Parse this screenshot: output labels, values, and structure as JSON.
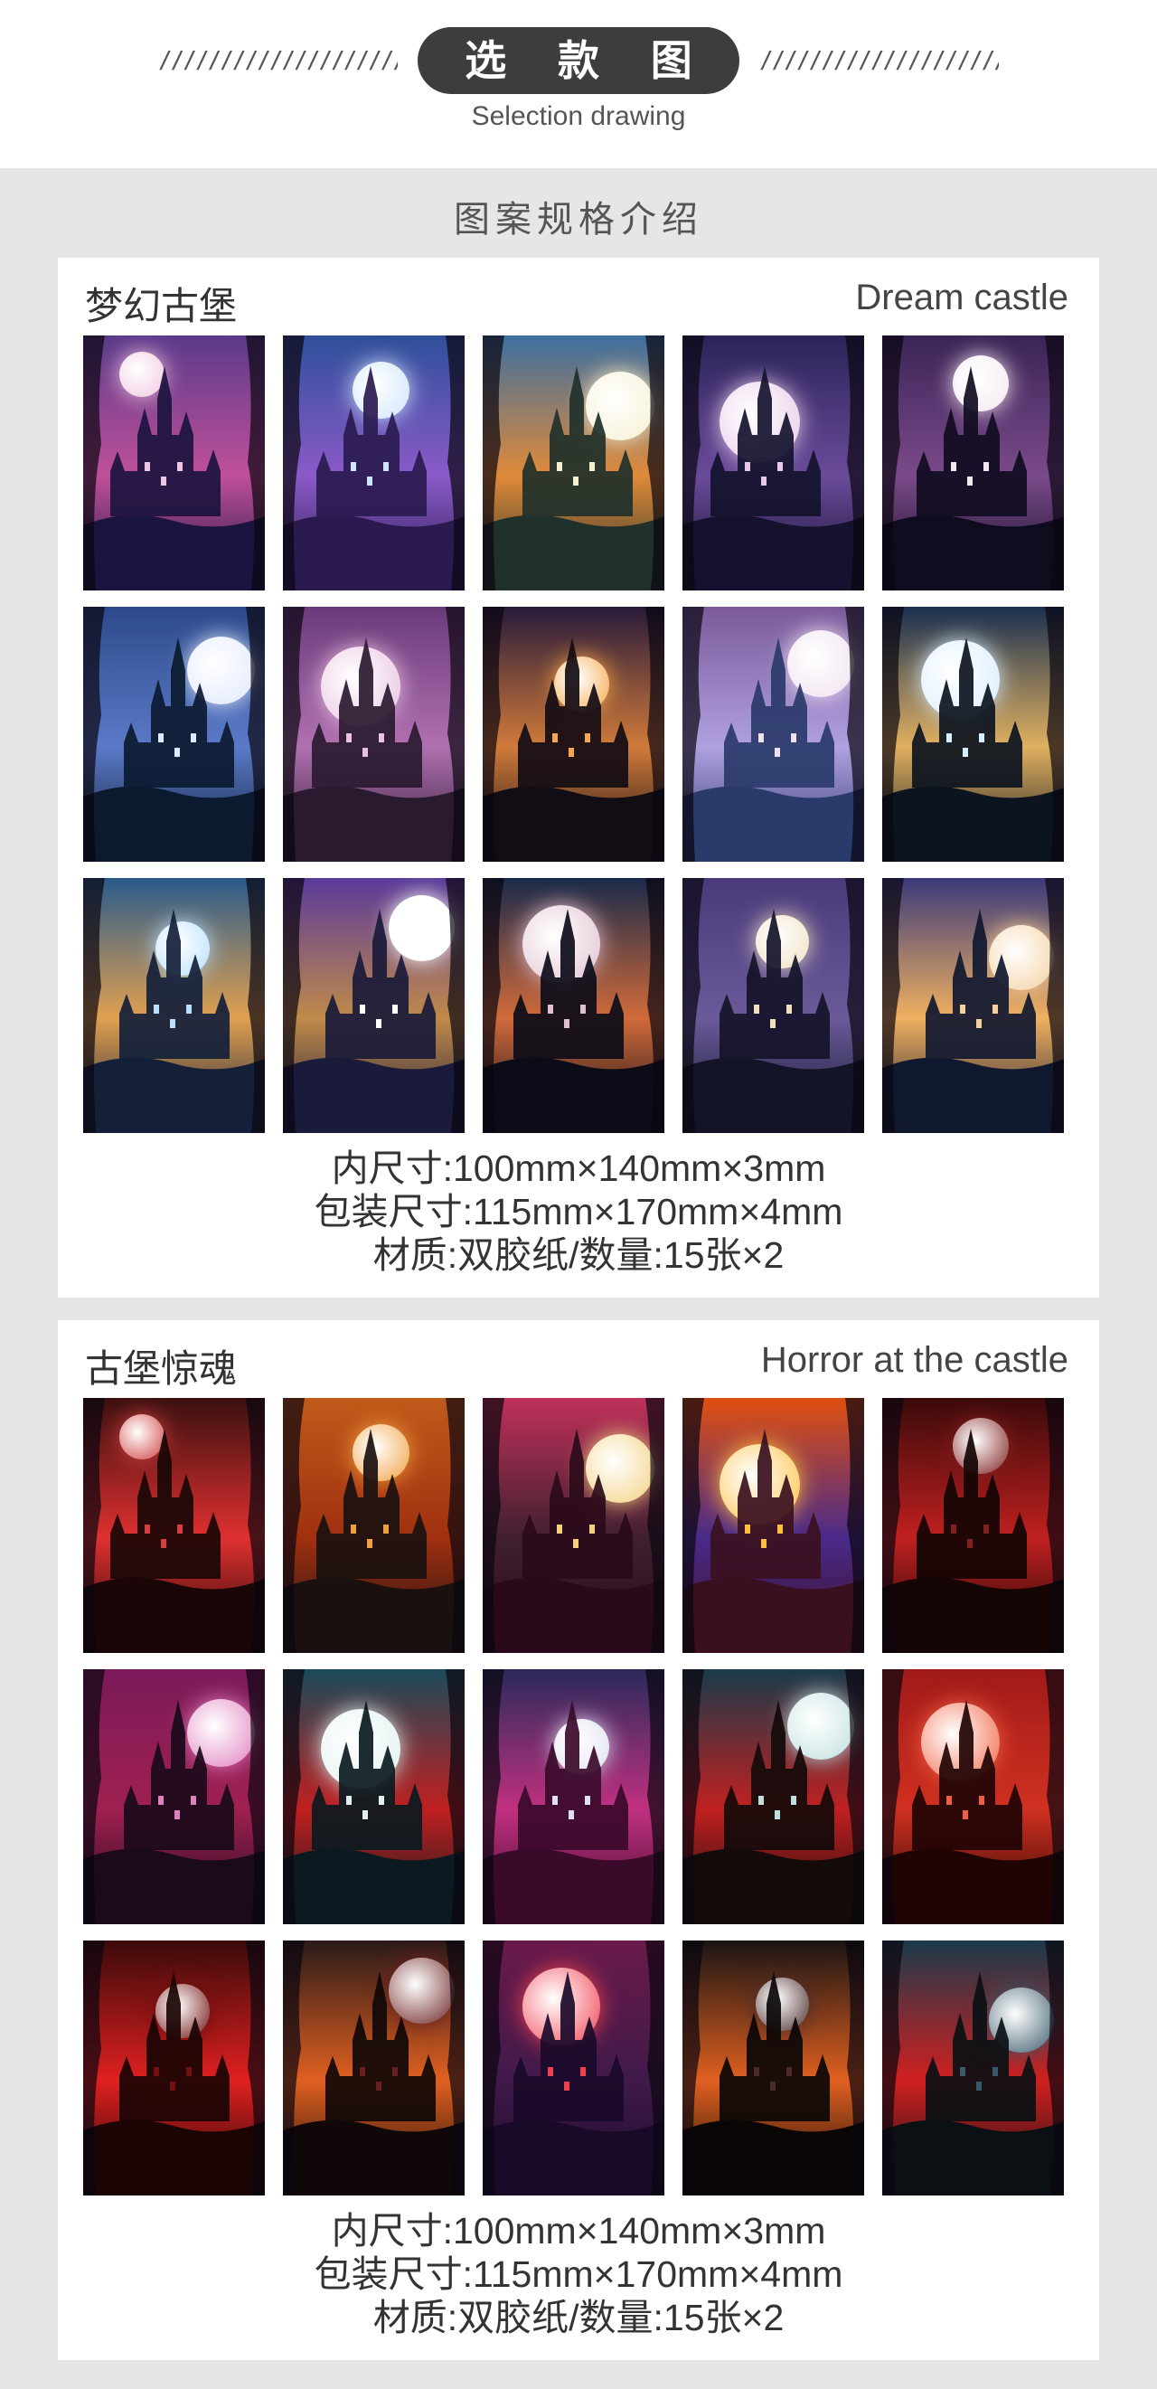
{
  "header": {
    "deco_left": "//////////////////////////",
    "deco_right": "//////////////////////////",
    "title": "选 款 图",
    "subtitle": "Selection drawing"
  },
  "section_heading": "图案规格介绍",
  "panels": [
    {
      "title_cn": "梦幻古堡",
      "title_en": "Dream castle",
      "specs": [
        "内尺寸:100mm×140mm×3mm",
        "包装尺寸:115mm×170mm×4mm",
        "材质:双胶纸/数量:15张×2"
      ],
      "cards": [
        {
          "name": "dream-castle-1",
          "sky": "#5a3a8a",
          "ground": "#1c1440",
          "moon": "#f0c6e0",
          "accent": "#c0509a"
        },
        {
          "name": "dream-castle-2",
          "sky": "#2f4f9a",
          "ground": "#2a1a50",
          "moon": "#cfe4ff",
          "accent": "#8a5ac8"
        },
        {
          "name": "dream-castle-3",
          "sky": "#3d6fa0",
          "ground": "#20302a",
          "moon": "#f6f0d0",
          "accent": "#e08a3a"
        },
        {
          "name": "dream-castle-4",
          "sky": "#2a2458",
          "ground": "#14122e",
          "moon": "#e8c8e8",
          "accent": "#6a4a9a"
        },
        {
          "name": "dream-castle-5",
          "sky": "#3a2456",
          "ground": "#100c20",
          "moon": "#f4e8f0",
          "accent": "#7a4a8a"
        },
        {
          "name": "dream-castle-6",
          "sky": "#2c4a8a",
          "ground": "#0c1a30",
          "moon": "#e0e8ff",
          "accent": "#5a7ac8"
        },
        {
          "name": "dream-castle-7",
          "sky": "#6a3a7a",
          "ground": "#2a1a30",
          "moon": "#e8c0e0",
          "accent": "#b070b0"
        },
        {
          "name": "dream-castle-8",
          "sky": "#281a3a",
          "ground": "#120c14",
          "moon": "#f4a84a",
          "accent": "#d07a3a"
        },
        {
          "name": "dream-castle-9",
          "sky": "#7a5a9a",
          "ground": "#2a3a6a",
          "moon": "#f0e0f0",
          "accent": "#b0a0e0"
        },
        {
          "name": "dream-castle-10",
          "sky": "#1a3050",
          "ground": "#0c1420",
          "moon": "#d8ecff",
          "accent": "#e0b060"
        },
        {
          "name": "dream-castle-11",
          "sky": "#2a5a8a",
          "ground": "#14203a",
          "moon": "#b8e0ff",
          "accent": "#e0a050"
        },
        {
          "name": "dream-castle-12",
          "sky": "#5a3a9a",
          "ground": "#1a1a3a",
          "moon": "#ffffff",
          "accent": "#c08a4a"
        },
        {
          "name": "dream-castle-13",
          "sky": "#1a2a4a",
          "ground": "#0c0c18",
          "moon": "#e0c0d0",
          "accent": "#d06a3a"
        },
        {
          "name": "dream-castle-14",
          "sky": "#4a3a7a",
          "ground": "#141428",
          "moon": "#f0e0c0",
          "accent": "#6a5a9a"
        },
        {
          "name": "dream-castle-15",
          "sky": "#3a3a7a",
          "ground": "#101830",
          "moon": "#f4d0a0",
          "accent": "#f0b060"
        }
      ]
    },
    {
      "title_cn": "古堡惊魂",
      "title_en": "Horror at the castle",
      "specs": [
        "内尺寸:100mm×140mm×3mm",
        "包装尺寸:115mm×170mm×4mm",
        "材质:双胶纸/数量:15张×2"
      ],
      "cards": [
        {
          "name": "horror-castle-1",
          "sky": "#3a1010",
          "ground": "#1a0606",
          "moon": "#d04040",
          "accent": "#e03030"
        },
        {
          "name": "horror-castle-2",
          "sky": "#c05a1a",
          "ground": "#1a1010",
          "moon": "#f0a040",
          "accent": "#a03010"
        },
        {
          "name": "horror-castle-3",
          "sky": "#c0305a",
          "ground": "#2a0a1a",
          "moon": "#f4d080",
          "accent": "#402030"
        },
        {
          "name": "horror-castle-4",
          "sky": "#e05010",
          "ground": "#3a1020",
          "moon": "#ffc040",
          "accent": "#4a2a8a"
        },
        {
          "name": "horror-castle-5",
          "sky": "#3a0a0a",
          "ground": "#140404",
          "moon": "#802020",
          "accent": "#c02020"
        },
        {
          "name": "horror-castle-6",
          "sky": "#7a1a5a",
          "ground": "#1a0a1a",
          "moon": "#e080c0",
          "accent": "#a02050"
        },
        {
          "name": "horror-castle-7",
          "sky": "#1a4a5a",
          "ground": "#0a1a20",
          "moon": "#e0f0f0",
          "accent": "#c02020"
        },
        {
          "name": "horror-castle-8",
          "sky": "#2a2a5a",
          "ground": "#3a0a2a",
          "moon": "#e0e0f0",
          "accent": "#c03080"
        },
        {
          "name": "horror-castle-9",
          "sky": "#1a3a4a",
          "ground": "#140a0a",
          "moon": "#c0e0e0",
          "accent": "#c02020"
        },
        {
          "name": "horror-castle-10",
          "sky": "#a01a1a",
          "ground": "#200404",
          "moon": "#f06040",
          "accent": "#d03020"
        },
        {
          "name": "horror-castle-11",
          "sky": "#3a0a0a",
          "ground": "#1a0404",
          "moon": "#701010",
          "accent": "#e02020"
        },
        {
          "name": "horror-castle-12",
          "sky": "#2a1a1a",
          "ground": "#100808",
          "moon": "#6a2020",
          "accent": "#e06020"
        },
        {
          "name": "horror-castle-13",
          "sky": "#6a1a4a",
          "ground": "#1a0a2a",
          "moon": "#f04050",
          "accent": "#401a4a"
        },
        {
          "name": "horror-castle-14",
          "sky": "#1a1414",
          "ground": "#0a0606",
          "moon": "#4a2a2a",
          "accent": "#e06020"
        },
        {
          "name": "horror-castle-15",
          "sky": "#1a3a4a",
          "ground": "#0a1014",
          "moon": "#3a5a6a",
          "accent": "#d02020"
        }
      ]
    }
  ]
}
